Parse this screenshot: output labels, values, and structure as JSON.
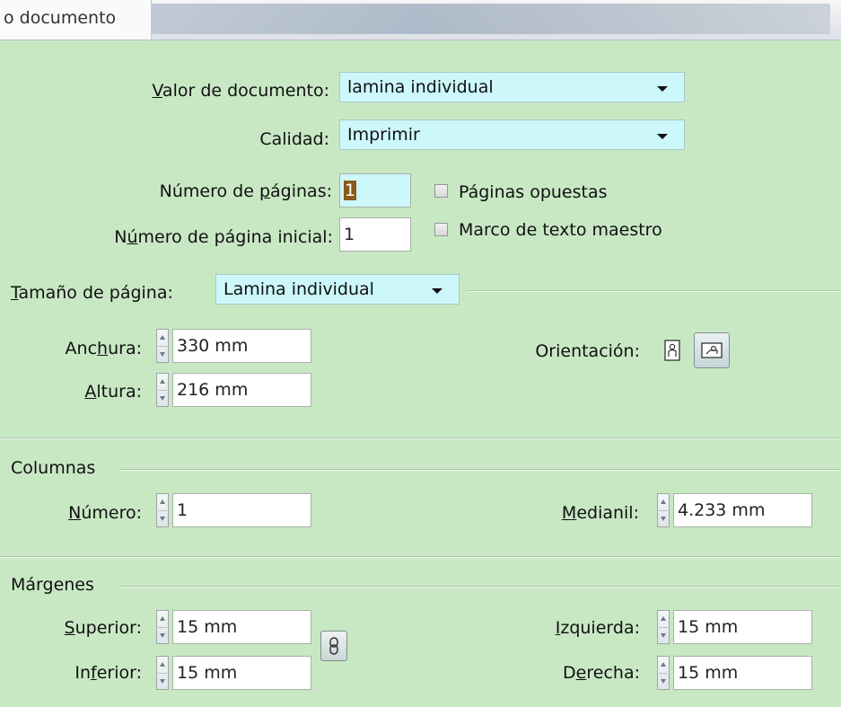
{
  "window": {
    "title": "o documento"
  },
  "document": {
    "preset_label": "Valor de documento:",
    "preset_value": "lamina individual",
    "quality_label": "Calidad:",
    "quality_value": "Imprimir",
    "pages_label": "Número de páginas:",
    "pages_value": "1",
    "start_page_label": "Número de página inicial:",
    "start_page_value": "1",
    "facing_pages_label": "Páginas opuestas",
    "facing_pages_checked": false,
    "master_text_label": "Marco de texto maestro",
    "master_text_checked": false
  },
  "page_size": {
    "label": "Tamaño de página:",
    "value": "Lamina individual",
    "width_label": "Anchura:",
    "width_value": "330 mm",
    "height_label": "Altura:",
    "height_value": "216 mm",
    "orientation_label": "Orientación:",
    "orientation_selected": "landscape"
  },
  "columns": {
    "section_label": "Columnas",
    "number_label": "Número:",
    "number_value": "1",
    "gutter_label": "Medianil:",
    "gutter_value": "4.233 mm"
  },
  "margins": {
    "section_label": "Márgenes",
    "top_label": "Superior:",
    "top_value": "15 mm",
    "bottom_label": "Inferior:",
    "bottom_value": "15 mm",
    "left_label": "Izquierda:",
    "left_value": "15 mm",
    "right_label": "Derecha:",
    "right_value": "15 mm"
  },
  "colors": {
    "panel": "#c8e8c4",
    "combo": "#ccf7fb",
    "selection": "#8a5a1a"
  }
}
